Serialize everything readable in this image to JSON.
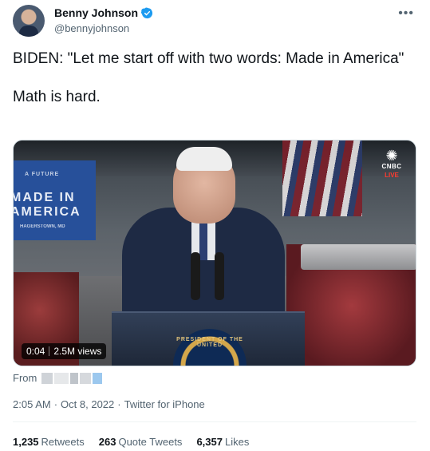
{
  "author": {
    "name": "Benny Johnson",
    "handle": "@bennyjohnson",
    "verified": true
  },
  "tweet": {
    "line1": "BIDEN: \"Let me start off with two words: Made in America\"",
    "line2": "Math is hard."
  },
  "media": {
    "banner_small": "A FUTURE",
    "banner_line1": "MADE IN",
    "banner_line2": "AMERICA",
    "banner_sub": "HAGERSTOWN, MD",
    "network": "CNBC",
    "live_label": "LIVE",
    "seal_text": "PRESIDENT OF THE UNITED",
    "duration": "0:04",
    "views": "2.5M views"
  },
  "source": {
    "from_label": "From"
  },
  "meta": {
    "time": "2:05 AM",
    "date": "Oct 8, 2022",
    "client": "Twitter for iPhone",
    "separator": "·"
  },
  "stats": {
    "retweets_count": "1,235",
    "retweets_label": "Retweets",
    "quotes_count": "263",
    "quotes_label": "Quote Tweets",
    "likes_count": "6,357",
    "likes_label": "Likes"
  },
  "colors": {
    "text": "#0f1419",
    "muted": "#536471",
    "verified": "#1d9bf0",
    "divider": "#eff3f4"
  }
}
